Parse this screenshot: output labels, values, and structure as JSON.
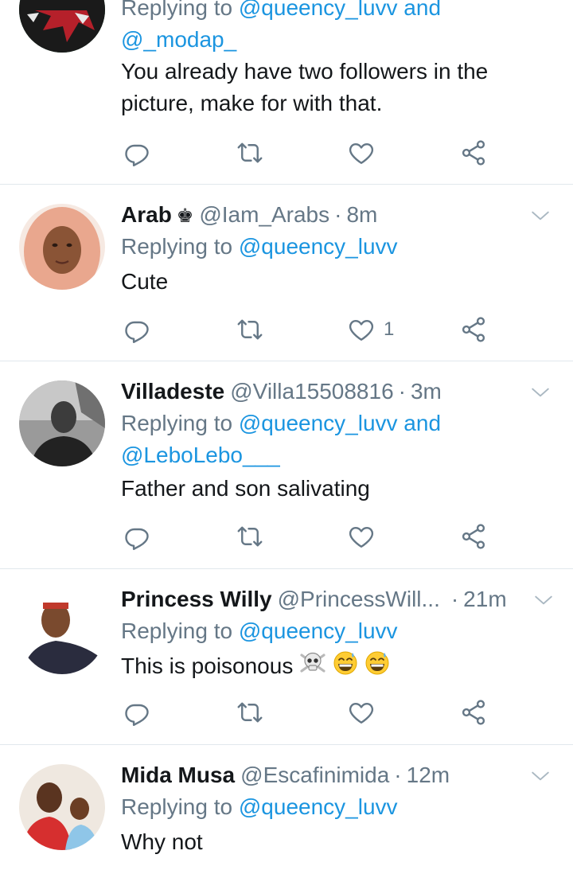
{
  "tweets": [
    {
      "name": "",
      "handle": "",
      "time": "",
      "reply_prefix": "Replying to",
      "mentions": "@queency_luvv and",
      "mentions2": "@_modap_",
      "text": "You already have two followers in the picture, make for with that.",
      "likes": ""
    },
    {
      "name": "Arab",
      "handle": "@Iam_Arabs",
      "dot": "·",
      "time": "8m",
      "reply_prefix": "Replying to",
      "mentions": "@queency_luvv",
      "text": "Cute",
      "likes": "1"
    },
    {
      "name": "Villadeste",
      "handle": "@Villa15508816",
      "dot": "·",
      "time": "3m",
      "reply_prefix": "Replying to",
      "mentions": "@queency_luvv and",
      "mentions2": "@LeboLebo___",
      "text": "Father and son salivating",
      "likes": ""
    },
    {
      "name": "Princess Willy",
      "handle": "@PrincessWill...",
      "dot": "·",
      "time": "21m",
      "reply_prefix": "Replying to",
      "mentions": "@queency_luvv",
      "text": "This is poisonous",
      "likes": ""
    },
    {
      "name": "Mida Musa",
      "handle": "@Escafinimida",
      "dot": "·",
      "time": "12m",
      "reply_prefix": "Replying to",
      "mentions": "@queency_luvv",
      "text": "Why not",
      "likes": ""
    }
  ],
  "icons": [
    "reply-icon",
    "retweet-icon",
    "like-icon",
    "share-icon",
    "chevron-down-icon",
    "crown-icon",
    "skull-icon",
    "grinning-sweat-icon"
  ],
  "colors": {
    "mention": "#1b95e0",
    "muted": "#657786",
    "text": "#14171a",
    "divider": "#e1e8ed"
  }
}
